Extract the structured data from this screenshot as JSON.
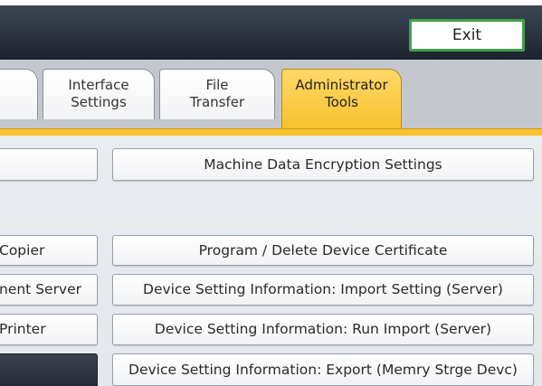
{
  "header": {
    "exit_label": "Exit"
  },
  "tabs": [
    {
      "line1": "",
      "line2": ""
    },
    {
      "line1": "Interface",
      "line2": "Settings"
    },
    {
      "line1": "File",
      "line2": "Transfer"
    },
    {
      "line1": "Administrator",
      "line2": "Tools"
    }
  ],
  "left_buttons": [
    {
      "label": ""
    },
    {
      "label": "Copier"
    },
    {
      "label": "nent Server"
    },
    {
      "label": "Printer"
    }
  ],
  "right_buttons": [
    {
      "label": "Machine Data Encryption Settings"
    },
    {
      "label": "Program / Delete Device Certificate"
    },
    {
      "label": "Device Setting Information: Import Setting (Server)"
    },
    {
      "label": "Device Setting Information: Run Import (Server)"
    },
    {
      "label": "Device Setting Information: Export (Memry Strge Devc)"
    }
  ],
  "colors": {
    "active_tab": "#f7c22b",
    "exit_border": "#3fa24a",
    "topbar": "#2c333f"
  }
}
